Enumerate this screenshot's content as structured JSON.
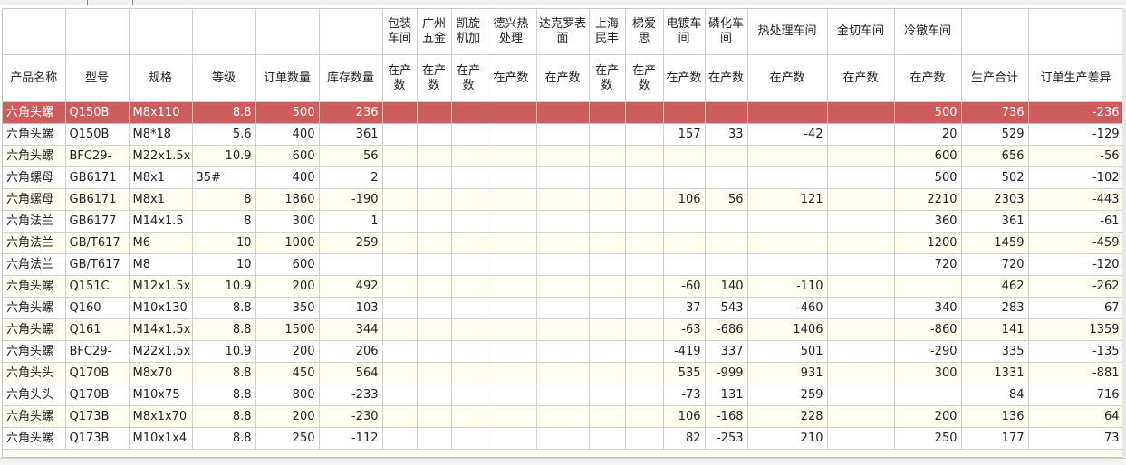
{
  "header_groups": [
    "",
    "",
    "",
    "",
    "",
    "",
    "包装车间",
    "广州五金",
    "凯旋机加",
    "德兴热处理",
    "达克罗表面",
    "上海民丰",
    "梯爱思",
    "电镀车间",
    "磷化车间",
    "热处理车间",
    "金切车间",
    "冷镦车间",
    "",
    ""
  ],
  "header_cols": [
    "产品名称",
    "型号",
    "规格",
    "等级",
    "订单数量",
    "库存数量",
    "在产数",
    "在产数",
    "在产数",
    "在产数",
    "在产数",
    "在产数",
    "在产数",
    "在产数",
    "在产数",
    "在产数",
    "在产数",
    "在产数",
    "生产合计",
    "订单生产差异"
  ],
  "rows": [
    {
      "name": "六角头螺",
      "model": "Q150B",
      "spec": "M8x110",
      "grade": "8.8",
      "order": "500",
      "stock": "236",
      "pack": "",
      "gz": "",
      "kx": "",
      "dx": "",
      "dkl": "",
      "sh": "",
      "tas": "",
      "dd": "",
      "lh": "",
      "rcl": "",
      "jq": "",
      "ld": "500",
      "total": "736",
      "diff": "-236"
    },
    {
      "name": "六角头螺",
      "model": "Q150B",
      "spec": "M8*18",
      "grade": "5.6",
      "order": "400",
      "stock": "361",
      "pack": "",
      "gz": "",
      "kx": "",
      "dx": "",
      "dkl": "",
      "sh": "",
      "tas": "",
      "dd": "157",
      "lh": "33",
      "rcl": "-42",
      "jq": "",
      "ld": "20",
      "total": "529",
      "diff": "-129"
    },
    {
      "name": "六角头螺",
      "model": "BFC29-",
      "spec": "M22x1.5x",
      "grade": "10.9",
      "order": "600",
      "stock": "56",
      "pack": "",
      "gz": "",
      "kx": "",
      "dx": "",
      "dkl": "",
      "sh": "",
      "tas": "",
      "dd": "",
      "lh": "",
      "rcl": "",
      "jq": "",
      "ld": "600",
      "total": "656",
      "diff": "-56"
    },
    {
      "name": "六角螺母",
      "model": "GB6171",
      "spec": "M8x1",
      "grade": "35#",
      "order": "400",
      "stock": "2",
      "pack": "",
      "gz": "",
      "kx": "",
      "dx": "",
      "dkl": "",
      "sh": "",
      "tas": "",
      "dd": "",
      "lh": "",
      "rcl": "",
      "jq": "",
      "ld": "500",
      "total": "502",
      "diff": "-102"
    },
    {
      "name": "六角螺母",
      "model": "GB6171",
      "spec": "M8x1",
      "grade": "8",
      "order": "1860",
      "stock": "-190",
      "pack": "",
      "gz": "",
      "kx": "",
      "dx": "",
      "dkl": "",
      "sh": "",
      "tas": "",
      "dd": "106",
      "lh": "56",
      "rcl": "121",
      "jq": "",
      "ld": "2210",
      "total": "2303",
      "diff": "-443"
    },
    {
      "name": "六角法兰",
      "model": "GB6177",
      "spec": "M14x1.5",
      "grade": "8",
      "order": "300",
      "stock": "1",
      "pack": "",
      "gz": "",
      "kx": "",
      "dx": "",
      "dkl": "",
      "sh": "",
      "tas": "",
      "dd": "",
      "lh": "",
      "rcl": "",
      "jq": "",
      "ld": "360",
      "total": "361",
      "diff": "-61"
    },
    {
      "name": "六角法兰",
      "model": "GB/T617",
      "spec": "M6",
      "grade": "10",
      "order": "1000",
      "stock": "259",
      "pack": "",
      "gz": "",
      "kx": "",
      "dx": "",
      "dkl": "",
      "sh": "",
      "tas": "",
      "dd": "",
      "lh": "",
      "rcl": "",
      "jq": "",
      "ld": "1200",
      "total": "1459",
      "diff": "-459"
    },
    {
      "name": "六角法兰",
      "model": "GB/T617",
      "spec": "M8",
      "grade": "10",
      "order": "600",
      "stock": "",
      "pack": "",
      "gz": "",
      "kx": "",
      "dx": "",
      "dkl": "",
      "sh": "",
      "tas": "",
      "dd": "",
      "lh": "",
      "rcl": "",
      "jq": "",
      "ld": "720",
      "total": "720",
      "diff": "-120"
    },
    {
      "name": "六角头螺",
      "model": "Q151C",
      "spec": "M12x1.5x",
      "grade": "10.9",
      "order": "200",
      "stock": "492",
      "pack": "",
      "gz": "",
      "kx": "",
      "dx": "",
      "dkl": "",
      "sh": "",
      "tas": "",
      "dd": "-60",
      "lh": "140",
      "rcl": "-110",
      "jq": "",
      "ld": "",
      "total": "462",
      "diff": "-262"
    },
    {
      "name": "六角头螺",
      "model": "Q160",
      "spec": "M10x130",
      "grade": "8.8",
      "order": "350",
      "stock": "-103",
      "pack": "",
      "gz": "",
      "kx": "",
      "dx": "",
      "dkl": "",
      "sh": "",
      "tas": "",
      "dd": "-37",
      "lh": "543",
      "rcl": "-460",
      "jq": "",
      "ld": "340",
      "total": "283",
      "diff": "67"
    },
    {
      "name": "六角头螺",
      "model": "Q161",
      "spec": "M14x1.5x",
      "grade": "8.8",
      "order": "1500",
      "stock": "344",
      "pack": "",
      "gz": "",
      "kx": "",
      "dx": "",
      "dkl": "",
      "sh": "",
      "tas": "",
      "dd": "-63",
      "lh": "-686",
      "rcl": "1406",
      "jq": "",
      "ld": "-860",
      "total": "141",
      "diff": "1359"
    },
    {
      "name": "六角头螺",
      "model": "BFC29-",
      "spec": "M22x1.5x",
      "grade": "10.9",
      "order": "200",
      "stock": "206",
      "pack": "",
      "gz": "",
      "kx": "",
      "dx": "",
      "dkl": "",
      "sh": "",
      "tas": "",
      "dd": "-419",
      "lh": "337",
      "rcl": "501",
      "jq": "",
      "ld": "-290",
      "total": "335",
      "diff": "-135"
    },
    {
      "name": "六角头头",
      "model": "Q170B",
      "spec": "M8x70",
      "grade": "8.8",
      "order": "450",
      "stock": "564",
      "pack": "",
      "gz": "",
      "kx": "",
      "dx": "",
      "dkl": "",
      "sh": "",
      "tas": "",
      "dd": "535",
      "lh": "-999",
      "rcl": "931",
      "jq": "",
      "ld": "300",
      "total": "1331",
      "diff": "-881"
    },
    {
      "name": "六角头头",
      "model": "Q170B",
      "spec": "M10x75",
      "grade": "8.8",
      "order": "800",
      "stock": "-233",
      "pack": "",
      "gz": "",
      "kx": "",
      "dx": "",
      "dkl": "",
      "sh": "",
      "tas": "",
      "dd": "-73",
      "lh": "131",
      "rcl": "259",
      "jq": "",
      "ld": "",
      "total": "84",
      "diff": "716"
    },
    {
      "name": "六角头螺",
      "model": "Q173B",
      "spec": "M8x1x70",
      "grade": "8.8",
      "order": "200",
      "stock": "-230",
      "pack": "",
      "gz": "",
      "kx": "",
      "dx": "",
      "dkl": "",
      "sh": "",
      "tas": "",
      "dd": "106",
      "lh": "-168",
      "rcl": "228",
      "jq": "",
      "ld": "200",
      "total": "136",
      "diff": "64"
    },
    {
      "name": "六角头螺",
      "model": "Q173B",
      "spec": "M10x1x4",
      "grade": "8.8",
      "order": "250",
      "stock": "-112",
      "pack": "",
      "gz": "",
      "kx": "",
      "dx": "",
      "dkl": "",
      "sh": "",
      "tas": "",
      "dd": "82",
      "lh": "-253",
      "rcl": "210",
      "jq": "",
      "ld": "250",
      "total": "177",
      "diff": "73"
    }
  ],
  "selected_row": 0,
  "colors": {
    "selected_bg": "#cd5c5c",
    "alt_bg": "#fffff0",
    "grid_line": "#d2d2d2"
  }
}
